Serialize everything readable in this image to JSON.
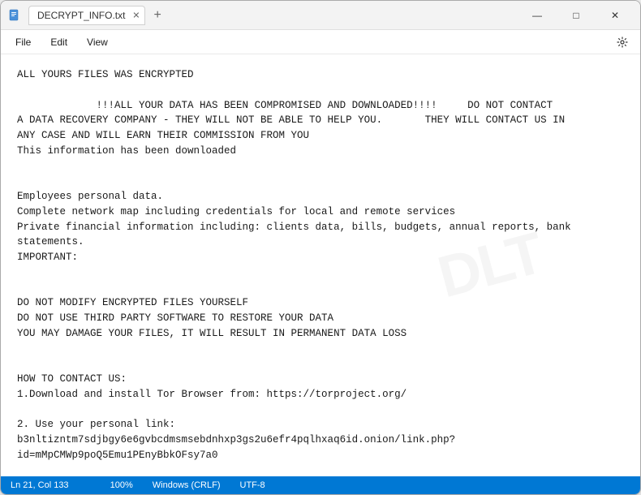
{
  "window": {
    "title": "DECRYPT_INFO.txt",
    "tab_label": "DECRYPT_INFO.txt",
    "tab_close": "✕",
    "tab_add": "+",
    "btn_minimize": "—",
    "btn_maximize": "□",
    "btn_close": "✕"
  },
  "menu": {
    "file": "File",
    "edit": "Edit",
    "view": "View"
  },
  "content": "ALL YOURS FILES WAS ENCRYPTED\n\n             !!!ALL YOUR DATA HAS BEEN COMPROMISED AND DOWNLOADED!!!!     DO NOT CONTACT\nA DATA RECOVERY COMPANY - THEY WILL NOT BE ABLE TO HELP YOU.       THEY WILL CONTACT US IN\nANY CASE AND WILL EARN THEIR COMMISSION FROM YOU\nThis information has been downloaded\n\n\nEmployees personal data.\nComplete network map including credentials for local and remote services\nPrivate financial information including: clients data, bills, budgets, annual reports, bank\nstatements.\nIMPORTANT:\n\n\nDO NOT MODIFY ENCRYPTED FILES YOURSELF\nDO NOT USE THIRD PARTY SOFTWARE TO RESTORE YOUR DATA\nYOU MAY DAMAGE YOUR FILES, IT WILL RESULT IN PERMANENT DATA LOSS\n\n\nHOW TO CONTACT US:\n1.Download and install Tor Browser from: https://torproject.org/\n\n2. Use your personal link:\nb3nltizntm7sdjbgy6e6gvbcdmsmsebdnhxp3gs2u6efr4pqlhxaq6id.onion/link.php?\nid=mMpCMWp9poQ5Emu1PEnyBbkOFsy7a0",
  "status": {
    "line_col": "Ln 21, Col 133",
    "zoom": "100%",
    "line_ending": "Windows (CRLF)",
    "encoding": "UTF-8"
  }
}
